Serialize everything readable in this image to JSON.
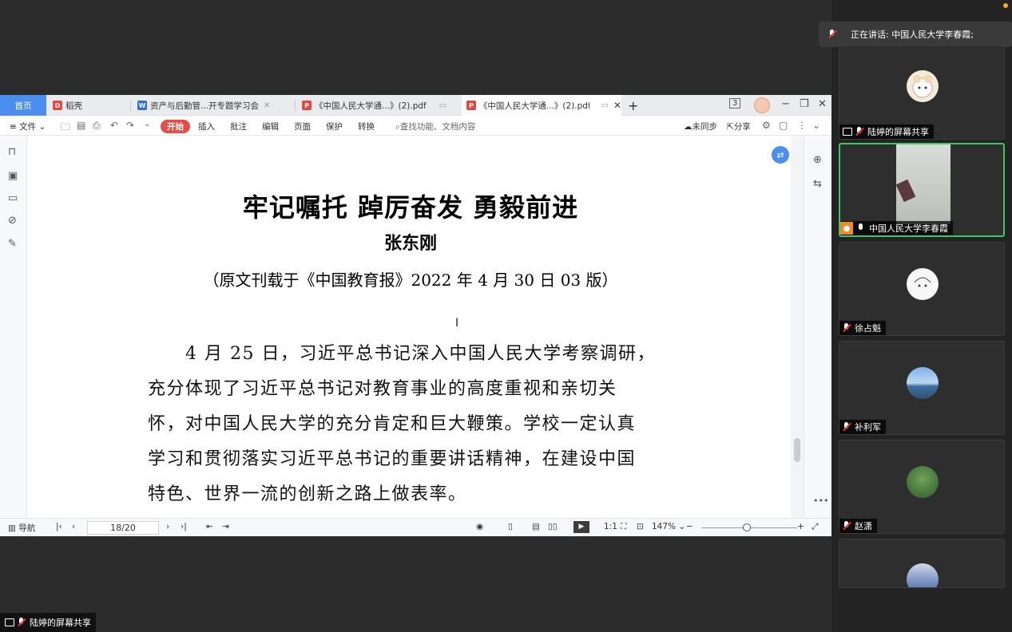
{
  "meeting": {
    "speaker_banner": "正在讲话: 中国人民大学李春霞;",
    "bottom_share_label": "陆婷的屏幕共享",
    "participants": [
      {
        "name": "陆婷的屏幕共享",
        "mic": "muted",
        "kind": "share"
      },
      {
        "name": "中国人民大学李春霞",
        "mic": "on",
        "kind": "video"
      },
      {
        "name": "徐占魁",
        "mic": "muted",
        "kind": "avatar"
      },
      {
        "name": "补利军",
        "mic": "muted",
        "kind": "avatar"
      },
      {
        "name": "赵潇",
        "mic": "muted",
        "kind": "avatar"
      }
    ]
  },
  "wps": {
    "tabs": {
      "home": "首页",
      "daoke": "稻壳",
      "doc1": "资产与后勤管...开专题学习会",
      "pdf1": "《中国人民大学通...》(2).pdf",
      "pdf2": "《中国人民大学通...》(2).pdf",
      "new_tab": "+",
      "badge": "3"
    },
    "menu": {
      "file": "文件",
      "start": "开始",
      "insert": "插入",
      "annotate": "批注",
      "edit": "编辑",
      "page": "页面",
      "protect": "保护",
      "convert": "转换",
      "search_placeholder": "查找功能、文档内容",
      "sync": "未同步",
      "share": "分享"
    },
    "document": {
      "title": "牢记嘱托 踔厉奋发 勇毅前进",
      "author": "张东刚",
      "source": "（原文刊载于《中国教育报》2022 年 4 月 30 日 03 版）",
      "paragraph_lines": [
        "　　4 月 25 日，习近平总书记深入中国人民大学考察调研，",
        "充分体现了习近平总书记对教育事业的高度重视和亲切关",
        "怀，对中国人民大学的充分肯定和巨大鞭策。学校一定认真",
        "学习和贯彻落实习近平总书记的重要讲话精神，在建设中国",
        "特色、世界一流的创新之路上做表率。"
      ]
    },
    "status": {
      "nav": "导航",
      "page": "18/20",
      "zoom": "147%"
    }
  }
}
